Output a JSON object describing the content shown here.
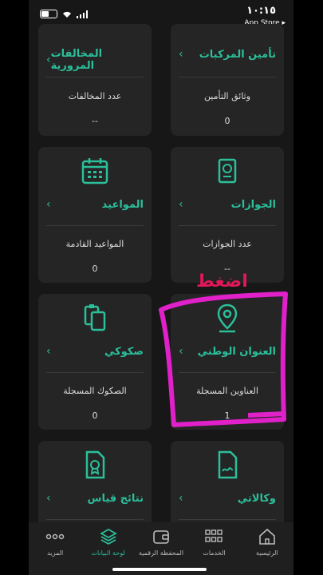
{
  "status": {
    "time": "١٠:١٥",
    "app_store": "App Store ▸"
  },
  "cards": [
    {
      "id": "insurance",
      "title": "تأمين المركبات",
      "label": "وثائق التأمين",
      "value": "0"
    },
    {
      "id": "violations",
      "title": "المخالفات المرورية",
      "label": "عدد المخالفات",
      "value": "--"
    },
    {
      "id": "passports",
      "title": "الجوازات",
      "label": "عدد الجوازات",
      "value": "--"
    },
    {
      "id": "appointments",
      "title": "المواعيد",
      "label": "المواعيد القادمة",
      "value": "0"
    },
    {
      "id": "address",
      "title": "العنوان الوطني",
      "label": "العناوين المسجلة",
      "value": "1"
    },
    {
      "id": "deeds",
      "title": "صكوكي",
      "label": "الصكوك المسجلة",
      "value": "0"
    },
    {
      "id": "agencies",
      "title": "وكالاتي",
      "label": "",
      "value": ""
    },
    {
      "id": "qiyas",
      "title": "نتائج قياس",
      "label": "",
      "value": ""
    }
  ],
  "annotation": {
    "text": "اضغط",
    "color": "#e0185a",
    "frame_color": "#e020c8"
  },
  "nav": [
    {
      "label": "المزيد",
      "icon": "more-dots-icon"
    },
    {
      "label": "لوحة البيانات",
      "icon": "layers-icon",
      "active": true
    },
    {
      "label": "المحفظة الرقمية",
      "icon": "wallet-icon"
    },
    {
      "label": "الخدمات",
      "icon": "grid-icon"
    },
    {
      "label": "الرئيسية",
      "icon": "home-icon"
    }
  ],
  "colors": {
    "accent": "#2bbf9a",
    "card": "#252525",
    "background": "#171717"
  }
}
